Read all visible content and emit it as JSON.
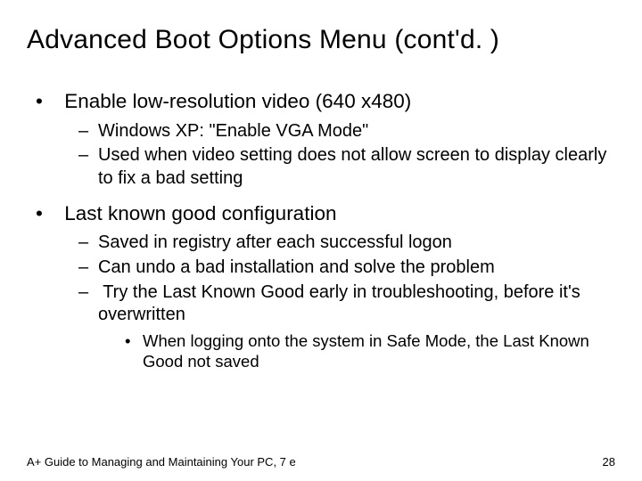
{
  "title": "Advanced Boot Options Menu (cont'd. )",
  "bullets": {
    "b1": "Enable low-resolution video (640 x480)",
    "b1_sub": {
      "s1": "Windows XP: \"Enable VGA Mode\"",
      "s2": "Used when video setting does not allow screen to display clearly to fix a bad setting"
    },
    "b2": "Last known good configuration",
    "b2_sub": {
      "s1": "Saved in registry after each successful logon",
      "s2": "Can undo a bad installation and solve the problem",
      "s3": "Try the Last Known Good early in troubleshooting, before it's overwritten",
      "s3_sub": {
        "t1": "When logging onto the system in Safe Mode, the Last Known Good not saved"
      }
    }
  },
  "footer": {
    "left": "A+ Guide to Managing and Maintaining Your PC, 7 e",
    "right": "28"
  }
}
